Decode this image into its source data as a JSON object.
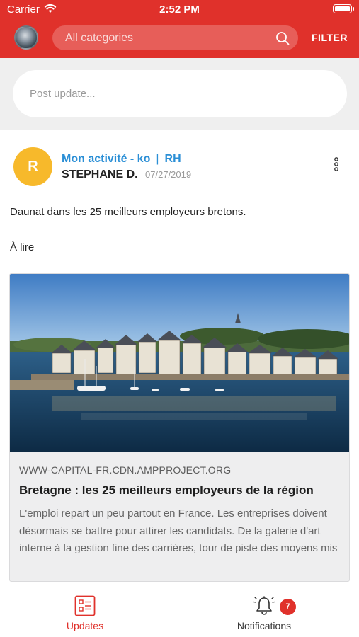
{
  "status_bar": {
    "carrier": "Carrier",
    "time": "2:52 PM"
  },
  "header": {
    "search_placeholder": "All categories",
    "filter_label": "FILTER"
  },
  "composer": {
    "placeholder": "Post update..."
  },
  "post": {
    "author_initial": "R",
    "category": "Mon activité - ko",
    "separator": "|",
    "group": "RH",
    "author_name": "STEPHANE D.",
    "date": "07/27/2019",
    "text": "Daunat dans les 25 meilleurs employeurs bretons.",
    "text_2": "À lire",
    "link": {
      "domain": "WWW-CAPITAL-FR.CDN.AMPPROJECT.ORG",
      "title": "Bretagne : les 25 meilleurs employeurs de la région",
      "description": "L'emploi repart un peu partout en France. Les entreprises doivent désormais se battre pour attirer les candidats. De la ga­lerie d'art interne à la gestion fine des carrières, tour de piste des moyens mis"
    }
  },
  "tabbar": {
    "updates_label": "Updates",
    "notifications_label": "Notifications",
    "notifications_badge": "7"
  },
  "colors": {
    "brand": "#e0312b",
    "accent_blue": "#2b8fd6",
    "avatar_yellow": "#f7b92b"
  },
  "icons": [
    "wifi-icon",
    "battery-icon",
    "search-icon",
    "more-vertical-icon",
    "updates-list-icon",
    "bell-icon"
  ]
}
